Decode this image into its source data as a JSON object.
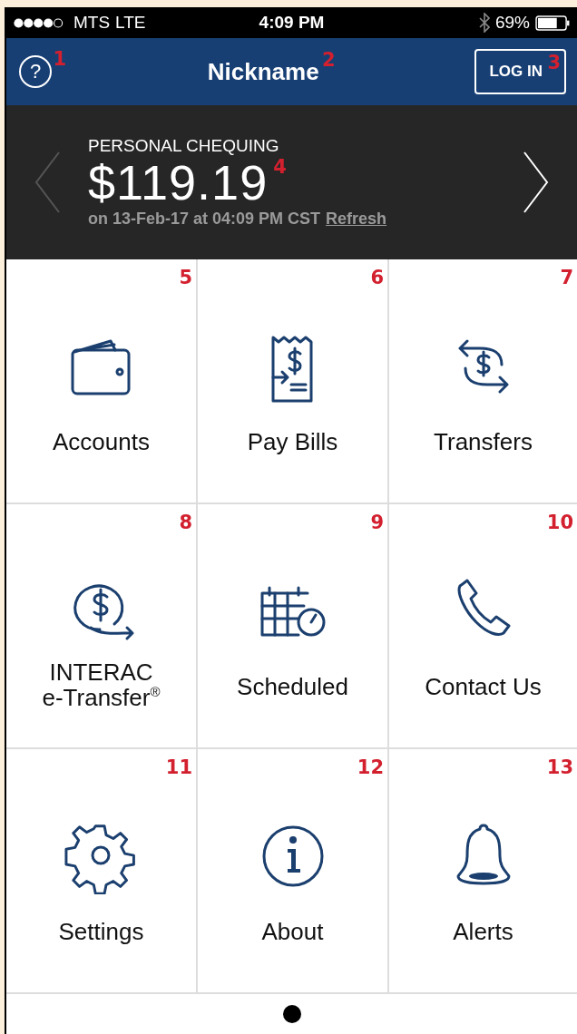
{
  "status_bar": {
    "carrier": "MTS",
    "network": "LTE",
    "time": "4:09 PM",
    "battery": "69%"
  },
  "nav_bar": {
    "help": {
      "label": "?",
      "marker": "1"
    },
    "title": "Nickname",
    "title_marker": "2",
    "login": {
      "label": "LOG IN",
      "marker": "3"
    }
  },
  "balance": {
    "account": "PERSONAL CHEQUING",
    "amount": "$119.19",
    "marker": "4",
    "updated": "on 13-Feb-17 at 04:09 PM CST",
    "refresh": "Refresh",
    "prev_disabled": true,
    "next_disabled": false
  },
  "tiles": [
    {
      "label": "Accounts",
      "marker": "5"
    },
    {
      "label": "Pay Bills",
      "marker": "6"
    },
    {
      "label": "Transfers",
      "marker": "7"
    },
    {
      "label": "INTERAC\ne-Transfer$^{®}$",
      "marker": "8"
    },
    {
      "label": "Scheduled",
      "marker": "9"
    },
    {
      "label": "Contact Us",
      "marker": "10"
    },
    {
      "label": "Settings",
      "marker": "11"
    },
    {
      "label": "About",
      "marker": "12"
    },
    {
      "label": "Alerts",
      "marker": "13"
    }
  ],
  "pages": [
    {
      "selected": true
    }
  ]
}
